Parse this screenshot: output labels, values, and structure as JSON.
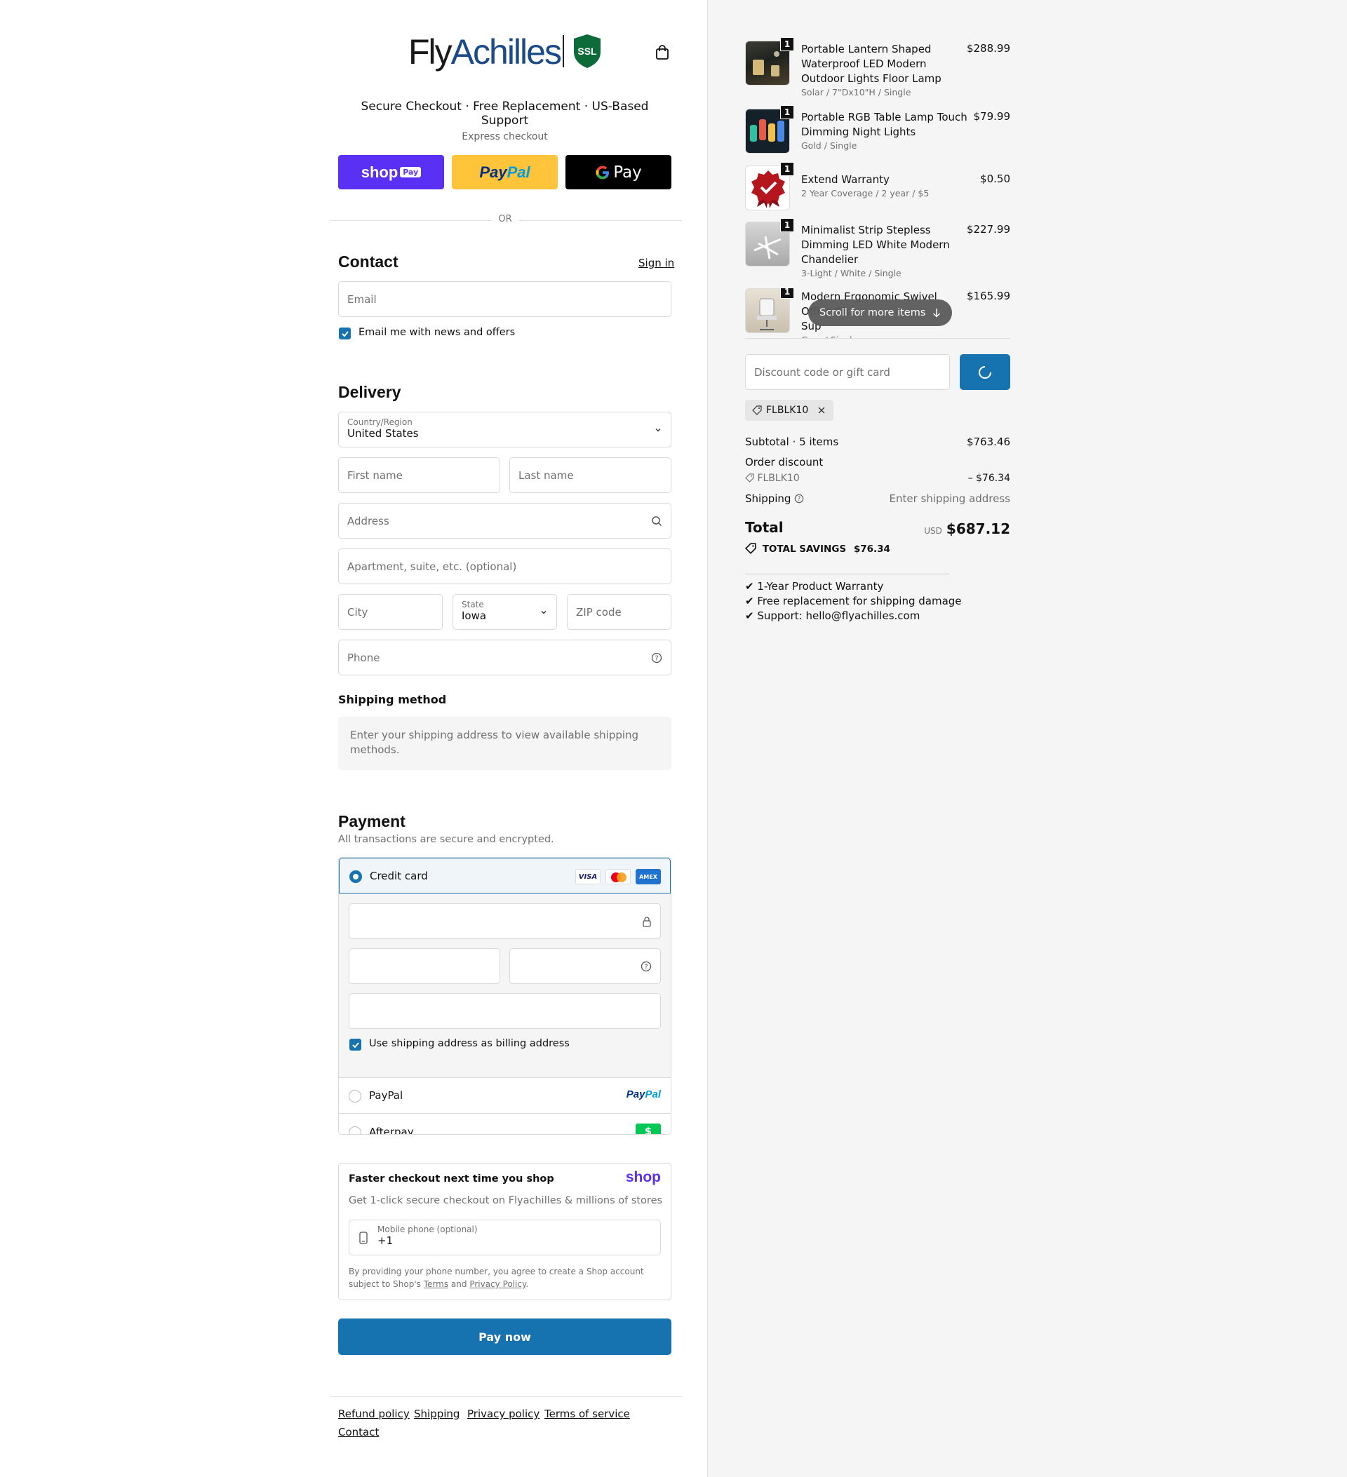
{
  "brand": {
    "logo_text_1": "Fly",
    "logo_text_2": "Achilles",
    "ssl_label": "SSL"
  },
  "tagline": "Secure Checkout · Free Replacement · US-Based Support",
  "express": {
    "title": "Express checkout",
    "shop_pay_label": "shop",
    "shop_pay_badge": "Pay",
    "paypal_label_1": "Pay",
    "paypal_label_2": "Pal",
    "gpay_label": "Pay",
    "or_text": "OR"
  },
  "contact": {
    "heading": "Contact",
    "sign_in": "Sign in",
    "email_placeholder": "Email",
    "newsletter_label": "Email me with news and offers"
  },
  "delivery": {
    "heading": "Delivery",
    "country_label": "Country/Region",
    "country_value": "United States",
    "first_name": "First name",
    "last_name": "Last name",
    "address": "Address",
    "apartment": "Apartment, suite, etc. (optional)",
    "city": "City",
    "state_label": "State",
    "state_value": "Iowa",
    "zip": "ZIP code",
    "phone": "Phone"
  },
  "shipping_method": {
    "heading": "Shipping method",
    "message": "Enter your shipping address to view available shipping methods."
  },
  "payment": {
    "heading": "Payment",
    "subtitle": "All transactions are secure and encrypted.",
    "credit_card_label": "Credit card",
    "card_brands": [
      "VISA",
      "MC",
      "AMEX"
    ],
    "billing_label": "Use shipping address as billing address",
    "paypal_label": "PayPal",
    "paypal_logo_1": "Pay",
    "paypal_logo_2": "Pal",
    "afterpay_label": "Afterpay",
    "afterpay_icon": "$"
  },
  "shop_promo": {
    "title": "Faster checkout next time you shop",
    "logo": "shop",
    "subtitle": "Get 1-click secure checkout on Flyachilles & millions of stores",
    "phone_label": "Mobile phone (optional)",
    "phone_value": "+1",
    "legal_1": "By providing your phone number, you agree to create a Shop account subject to Shop's",
    "legal_terms": "Terms",
    "legal_and": "and",
    "legal_privacy": "Privacy Policy",
    "legal_end": "."
  },
  "pay_now": "Pay now",
  "footer": [
    "Refund policy",
    "Shipping",
    "Privacy policy",
    "Terms of service",
    "Contact"
  ],
  "cart": {
    "items": [
      {
        "qty": "1",
        "name": "Portable Lantern Shaped Waterproof LED Modern Outdoor Lights Floor Lamp",
        "variant": "Solar / 7\"Dx10\"H / Single",
        "price": "$288.99"
      },
      {
        "qty": "1",
        "name": "Portable RGB Table Lamp Touch Dimming Night Lights",
        "variant": "Gold / Single",
        "price": "$79.99"
      },
      {
        "qty": "1",
        "name": "Extend Warranty",
        "variant": "2 Year Coverage / 2 year / $5",
        "price": "$0.50"
      },
      {
        "qty": "1",
        "name": "Minimalist Strip Stepless Dimming LED White Modern Chandelier",
        "variant": "3-Light / White / Single",
        "price": "$227.99"
      },
      {
        "qty": "1",
        "name": "Modern Ergonomic Swivel Office Ch",
        "name_line3": "Sup",
        "variant": "Grey / Single",
        "price": "$165.99"
      }
    ],
    "scroll_hint": "Scroll for more items",
    "discount_placeholder": "Discount code or gift card",
    "applied_code": "FLBLK10",
    "subtotal_label": "Subtotal · 5 items",
    "subtotal_value": "$763.46",
    "order_discount_label": "Order discount",
    "discount_code": "FLBLK10",
    "discount_value": "– $76.34",
    "shipping_label": "Shipping",
    "shipping_value": "Enter shipping address",
    "total_label": "Total",
    "currency": "USD",
    "total_value": "$687.12",
    "savings_label": "TOTAL SAVINGS",
    "savings_value": "$76.34",
    "guarantees": [
      "✔ 1-Year Product Warranty",
      "✔ Free replacement for shipping damage",
      "✔ Support: hello@flyachilles.com"
    ]
  },
  "colors": {
    "accent": "#1773b0",
    "shop_purple": "#5a31f4",
    "paypal_yellow": "#ffc439",
    "ssl_green": "#0d6b3a"
  }
}
